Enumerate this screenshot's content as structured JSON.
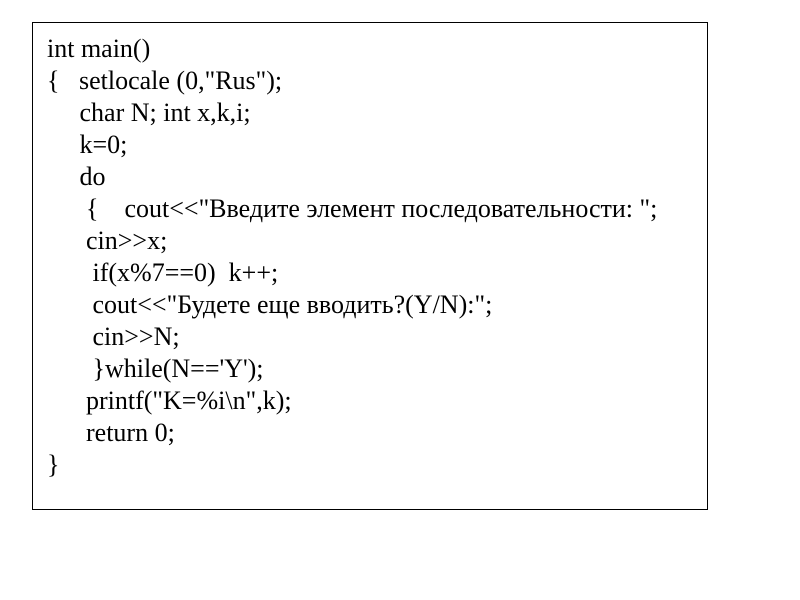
{
  "code": {
    "lines": [
      "int main()",
      "{   setlocale (0,\"Rus\");",
      "     char N; int x,k,i;",
      "     k=0;",
      "     do",
      "      {    cout<<\"Введите элемент последовательности: \";",
      "      cin>>x;",
      "       if(x%7==0)  k++;",
      "       cout<<\"Будете еще вводить?(Y/N):\";",
      "       cin>>N;",
      "       }while(N=='Y');",
      "      printf(\"K=%i\\n\",k);",
      "      return 0;",
      "}"
    ]
  }
}
